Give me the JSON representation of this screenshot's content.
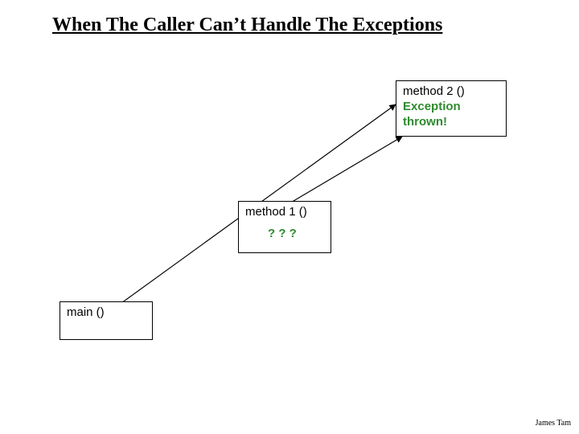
{
  "title": "When The Caller Can’t Handle The Exceptions",
  "box_method2": {
    "label": "method 2 ()",
    "exception_line1": "Exception",
    "exception_line2": "thrown!"
  },
  "box_method1": {
    "label": "method 1 ()",
    "question": "? ? ?"
  },
  "box_main": {
    "label": "main ()"
  },
  "footer": "James Tam"
}
